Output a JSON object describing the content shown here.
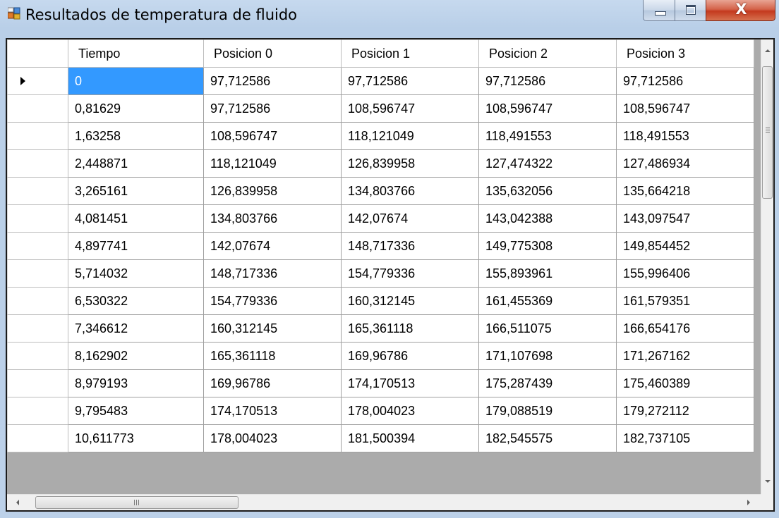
{
  "window": {
    "title": "Resultados de temperatura de fluido",
    "close_label": "X"
  },
  "grid": {
    "columns": [
      "Tiempo",
      "Posicion 0",
      "Posicion 1",
      "Posicion 2",
      "Posicion 3"
    ],
    "selected_cell": {
      "row": 0,
      "col": 0
    },
    "current_row_indicator": 0,
    "rows": [
      [
        "0",
        "97,712586",
        "97,712586",
        "97,712586",
        "97,712586"
      ],
      [
        "0,81629",
        "97,712586",
        "108,596747",
        "108,596747",
        "108,596747"
      ],
      [
        "1,63258",
        "108,596747",
        "118,121049",
        "118,491553",
        "118,491553"
      ],
      [
        "2,448871",
        "118,121049",
        "126,839958",
        "127,474322",
        "127,486934"
      ],
      [
        "3,265161",
        "126,839958",
        "134,803766",
        "135,632056",
        "135,664218"
      ],
      [
        "4,081451",
        "134,803766",
        "142,07674",
        "143,042388",
        "143,097547"
      ],
      [
        "4,897741",
        "142,07674",
        "148,717336",
        "149,775308",
        "149,854452"
      ],
      [
        "5,714032",
        "148,717336",
        "154,779336",
        "155,893961",
        "155,996406"
      ],
      [
        "6,530322",
        "154,779336",
        "160,312145",
        "161,455369",
        "161,579351"
      ],
      [
        "7,346612",
        "160,312145",
        "165,361118",
        "166,511075",
        "166,654176"
      ],
      [
        "8,162902",
        "165,361118",
        "169,96786",
        "171,107698",
        "171,267162"
      ],
      [
        "8,979193",
        "169,96786",
        "174,170513",
        "175,287439",
        "175,460389"
      ],
      [
        "9,795483",
        "174,170513",
        "178,004023",
        "179,088519",
        "179,272112"
      ],
      [
        "10,611773",
        "178,004023",
        "181,500394",
        "182,545575",
        "182,737105"
      ]
    ]
  },
  "colors": {
    "selection": "#3399ff",
    "close_button": "#c4391e"
  }
}
